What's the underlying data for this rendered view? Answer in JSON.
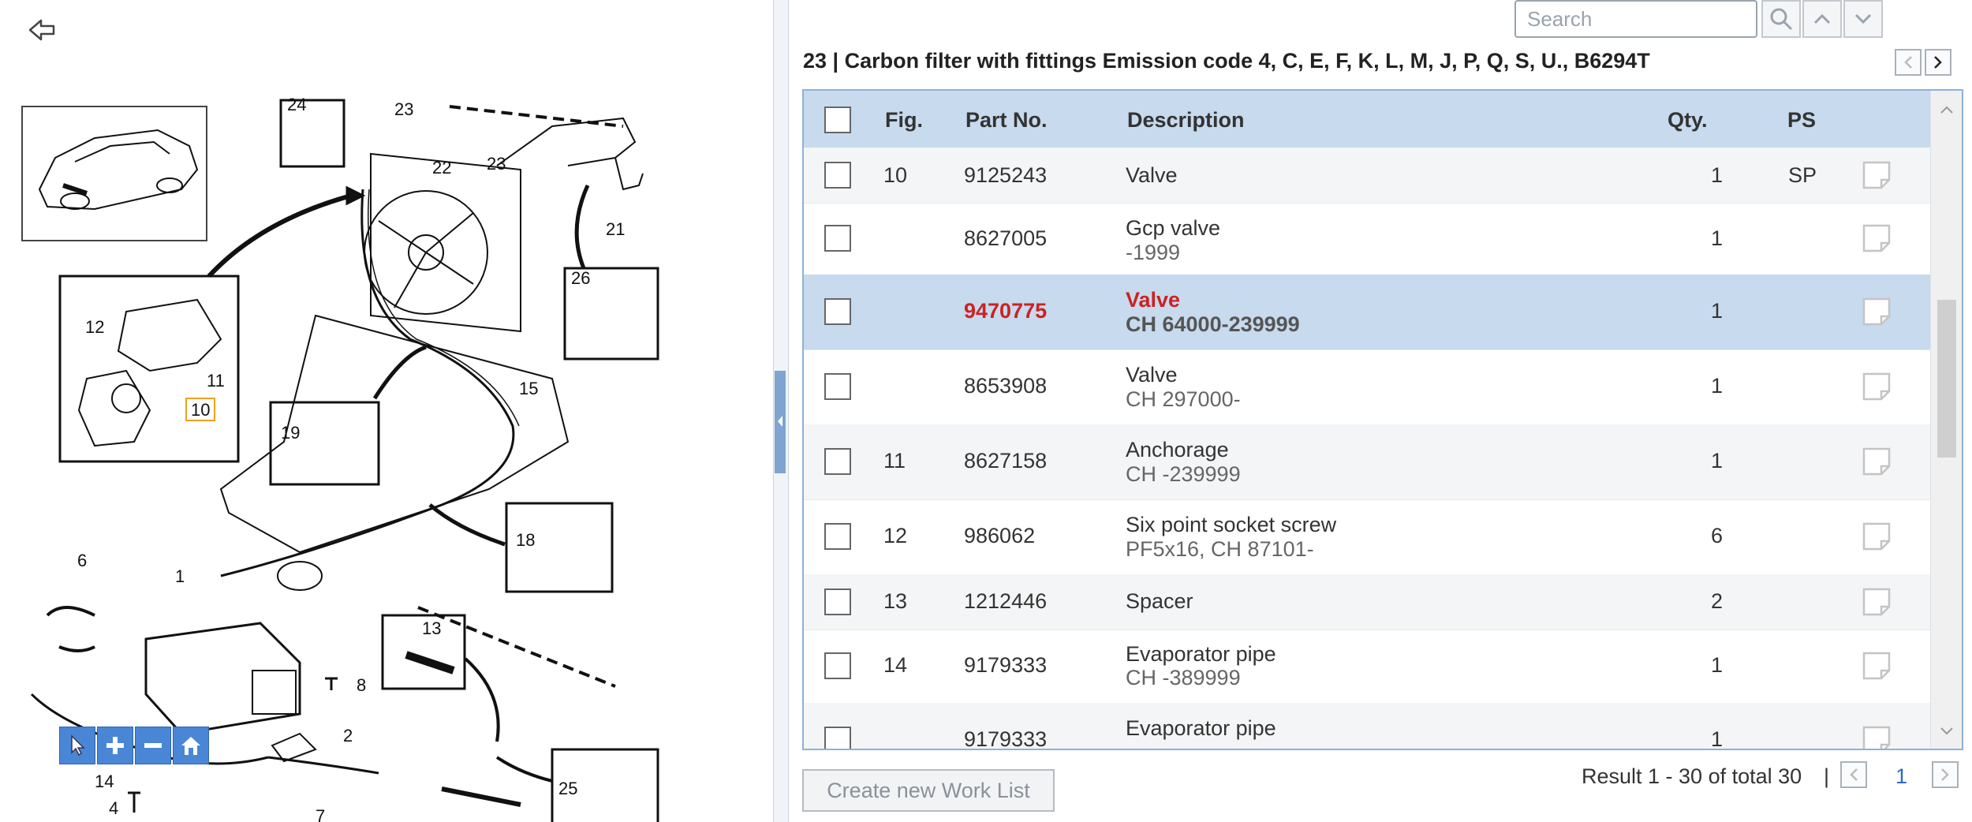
{
  "left_pane": {
    "back_icon": "back-arrow-icon",
    "callouts": [
      "24",
      "23",
      "22",
      "23",
      "21",
      "26",
      "12",
      "11",
      "10",
      "19",
      "15",
      "18",
      "6",
      "1",
      "8",
      "13",
      "2",
      "14",
      "25",
      "4",
      "7"
    ],
    "zoom_toolbar": [
      "pointer-icon",
      "zoom-in-icon",
      "zoom-out-icon",
      "home-icon"
    ]
  },
  "search": {
    "placeholder": "Search",
    "value": ""
  },
  "header": {
    "title": "23  |  Carbon filter with fittings Emission code 4, C, E, F, K, L, M, J, P, Q, S, U., B6294T"
  },
  "table": {
    "columns": {
      "fig": "Fig.",
      "part_no": "Part No.",
      "description": "Description",
      "qty": "Qty.",
      "ps": "PS"
    },
    "rows": [
      {
        "fig": "10",
        "part_no": "9125243",
        "desc": "Valve",
        "sub": "",
        "qty": "1",
        "ps": "SP"
      },
      {
        "fig": "",
        "part_no": "8627005",
        "desc": "Gcp valve",
        "sub": "-1999",
        "qty": "1",
        "ps": ""
      },
      {
        "fig": "",
        "part_no": "9470775",
        "desc": "Valve",
        "sub": "CH 64000-239999",
        "qty": "1",
        "ps": ""
      },
      {
        "fig": "",
        "part_no": "8653908",
        "desc": "Valve",
        "sub": "CH 297000-",
        "qty": "1",
        "ps": ""
      },
      {
        "fig": "11",
        "part_no": "8627158",
        "desc": "Anchorage",
        "sub": "CH -239999",
        "qty": "1",
        "ps": ""
      },
      {
        "fig": "12",
        "part_no": "986062",
        "desc": "Six point socket screw",
        "sub": "PF5x16, CH 87101-",
        "qty": "6",
        "ps": ""
      },
      {
        "fig": "13",
        "part_no": "1212446",
        "desc": "Spacer",
        "sub": "",
        "qty": "2",
        "ps": ""
      },
      {
        "fig": "14",
        "part_no": "9179333",
        "desc": "Evaporator pipe",
        "sub": "CH -389999",
        "qty": "1",
        "ps": ""
      },
      {
        "fig": "",
        "part_no": "9179333",
        "desc": "Evaporator pipe",
        "sub": "",
        "qty": "1",
        "ps": ""
      }
    ],
    "selected_part": "9470775"
  },
  "footer": {
    "worklist_button": "Create new Work List",
    "result_text": "Result 1 - 30 of total 30",
    "separator": "|",
    "page": "1"
  },
  "colors": {
    "header_bg": "#c7daee",
    "selected_text": "#cc2222",
    "zoom_buttons": "#4a86d6",
    "divider_grip": "#7ea4cf"
  }
}
